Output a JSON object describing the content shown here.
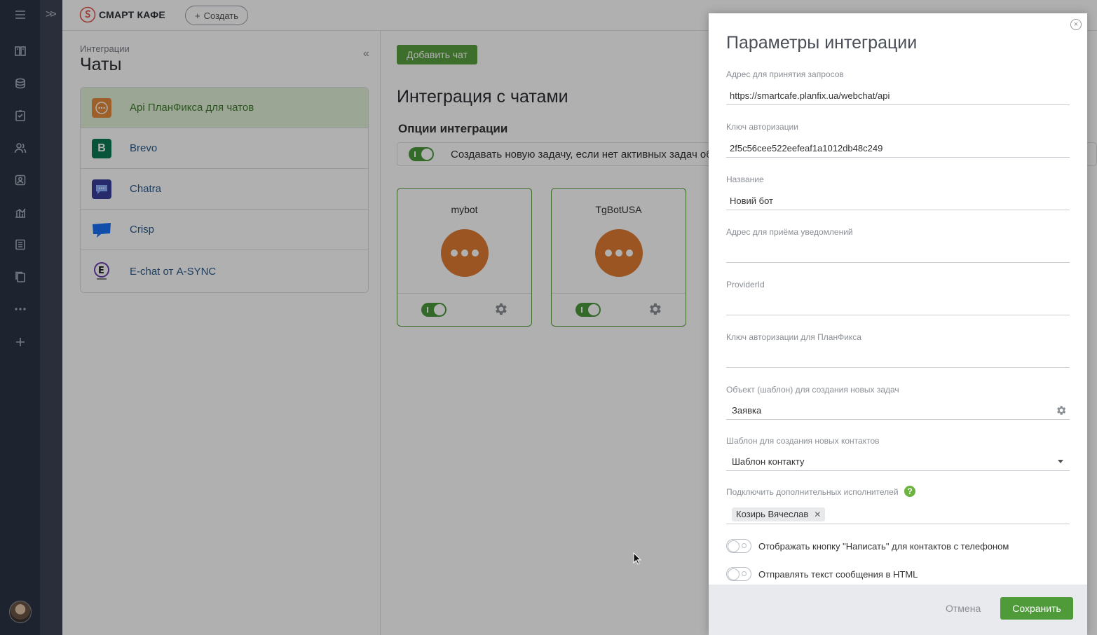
{
  "app": {
    "logo_text": "СМАРТ КАФЕ",
    "create_label": "Создать"
  },
  "rail": {
    "icons": [
      "menu-icon",
      "dashboard-icon",
      "inbox-icon",
      "tasks-icon",
      "contacts-icon",
      "profile-icon",
      "reports-icon",
      "documents-icon",
      "files-icon",
      "more-icon",
      "add-icon"
    ]
  },
  "left_panel": {
    "breadcrumb": "Интеграции",
    "title": "Чаты",
    "items": [
      {
        "label": "Api ПланФикса для чатов",
        "active": true,
        "icon": "api-chat-icon",
        "color": "#e58a3a"
      },
      {
        "label": "Brevo",
        "active": false,
        "icon": "brevo-icon",
        "color": "#0b7a55"
      },
      {
        "label": "Chatra",
        "active": false,
        "icon": "chatra-icon",
        "color": "#3a3f9b"
      },
      {
        "label": "Crisp",
        "active": false,
        "icon": "crisp-icon",
        "color": "#1972f5"
      },
      {
        "label": "E-chat от A-SYNC",
        "active": false,
        "icon": "echat-icon",
        "color": "#6a3fb0"
      }
    ]
  },
  "main": {
    "add_chat_label": "Добавить чат",
    "title": "Интеграция с чатами",
    "options_title": "Опции интеграции",
    "option_create_task": "Создавать новую задачу, если нет активных задач об",
    "cards": [
      {
        "name": "mybot",
        "enabled": true
      },
      {
        "name": "TgBotUSA",
        "enabled": true
      }
    ]
  },
  "modal": {
    "title": "Параметры интеграции",
    "fields": {
      "requests_url": {
        "label": "Адрес для принятия запросов",
        "value": "https://smartcafe.planfix.ua/webchat/api"
      },
      "auth_key": {
        "label": "Ключ авторизации",
        "value": "2f5c56cee522eefeaf1a1012db48c249"
      },
      "name": {
        "label": "Название",
        "value": "Новий бот"
      },
      "notify_url": {
        "label": "Адрес для приёма уведомлений",
        "value": ""
      },
      "provider_id": {
        "label": "ProviderId",
        "value": ""
      },
      "planfix_key": {
        "label": "Ключ авторизации для ПланФикса",
        "value": ""
      },
      "task_template": {
        "label": "Объект (шаблон) для создания новых задач",
        "value": "Заявка"
      },
      "contact_template": {
        "label": "Шаблон для создания новых контактов",
        "value": "Шаблон контакту"
      },
      "extra_assignees": {
        "label": "Подключить дополнительных исполнителей",
        "chip": "Козирь Вячеслав"
      }
    },
    "switches": {
      "show_write_button": {
        "label": "Отображать кнопку \"Написать\" для контактов с телефоном",
        "on": false
      },
      "send_html": {
        "label": "Отправлять текст сообщения в HTML",
        "on": false
      }
    },
    "footer": {
      "cancel": "Отмена",
      "save": "Сохранить"
    }
  },
  "colors": {
    "accent": "#4f9b3a",
    "rail": "#2c3446",
    "orange": "#e07b32"
  }
}
